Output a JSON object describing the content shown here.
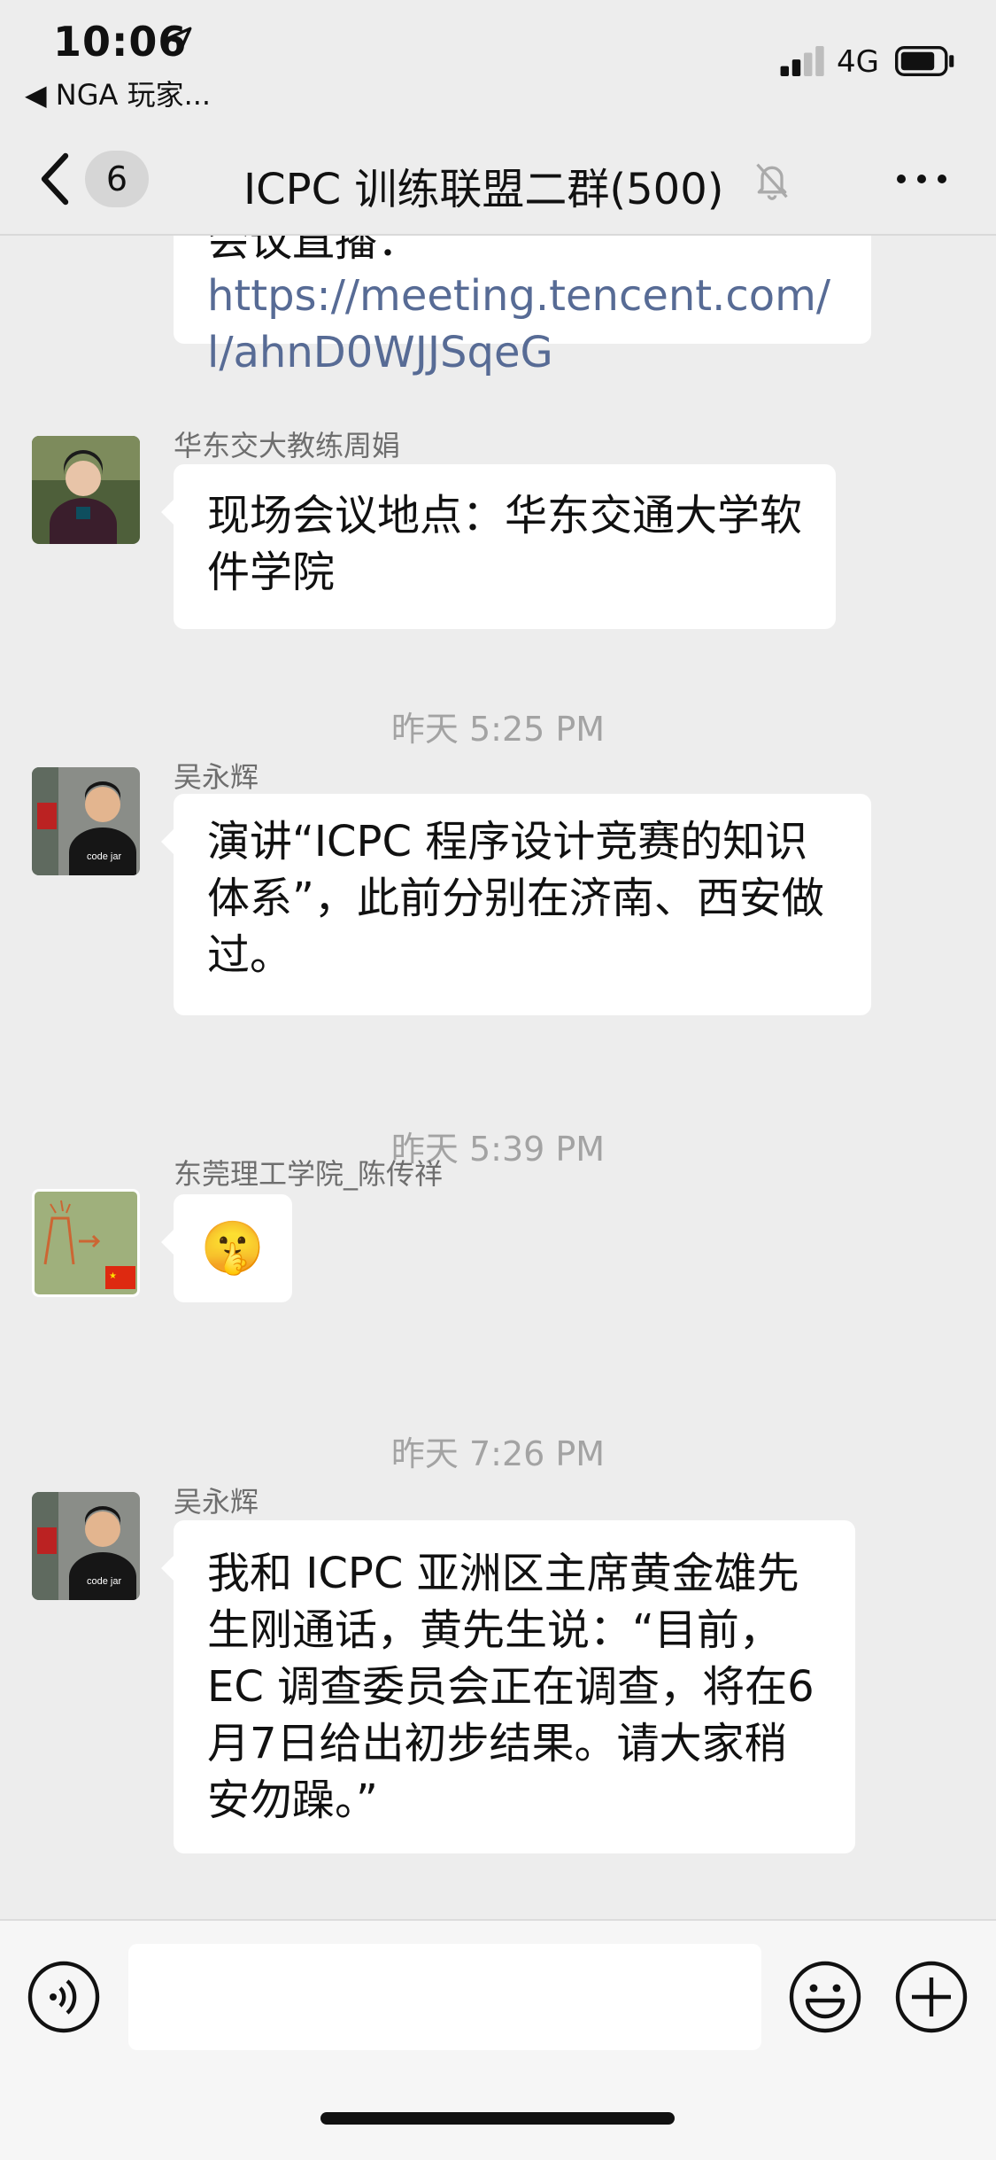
{
  "status_bar": {
    "time": "10:06",
    "back_app": "◀ NGA 玩家...",
    "network": "4G"
  },
  "nav": {
    "unread_count": "6",
    "title": "ICPC 训练联盟二群(500)"
  },
  "messages": [
    {
      "text_top": "会议直播：",
      "link": "https://meeting.tencent.com/l/ahnD0WJJSqeG"
    },
    {
      "sender": "华东交大教练周娟",
      "text": "现场会议地点：华东交通大学软件学院"
    },
    {
      "timestamp": "昨天 5:25 PM",
      "sender": "吴永辉",
      "text": "演讲“ICPC 程序设计竞赛的知识体系”，此前分别在济南、西安做过。",
      "avatar_shirt_text": "code jar"
    },
    {
      "timestamp": "昨天 5:39 PM",
      "sender": "东莞理工学院_陈传祥",
      "emoji": "🤫"
    },
    {
      "timestamp": "昨天 7:26 PM",
      "sender": "吴永辉",
      "text": "我和 ICPC 亚洲区主席黄金雄先生刚通话，黄先生说：“目前，EC 调查委员会正在调查，将在6月7日给出初步结果。请大家稍安勿躁。”",
      "avatar_shirt_text": "code jar"
    }
  ],
  "input": {
    "placeholder": ""
  }
}
